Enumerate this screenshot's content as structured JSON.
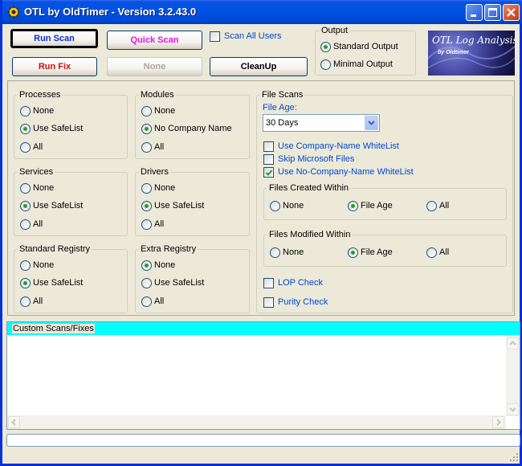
{
  "window": {
    "title": "OTL by OldTimer - Version 3.2.43.0"
  },
  "toolbar": {
    "run_scan": "Run Scan",
    "quick_scan": "Quick Scan",
    "scan_all_users": "Scan All Users",
    "run_fix": "Run Fix",
    "none": "None",
    "cleanup": "CleanUp"
  },
  "output": {
    "label": "Output",
    "standard": "Standard Output",
    "minimal": "Minimal Output",
    "selected": "Standard Output"
  },
  "logo": {
    "title": "OTL Log Analysis",
    "subtitle": "by Oldtimer"
  },
  "groups": {
    "processes": {
      "label": "Processes",
      "options": [
        "None",
        "Use SafeList",
        "All"
      ],
      "selected": "Use SafeList"
    },
    "modules": {
      "label": "Modules",
      "options": [
        "None",
        "No Company Name",
        "All"
      ],
      "selected": "No Company Name"
    },
    "services": {
      "label": "Services",
      "options": [
        "None",
        "Use SafeList",
        "All"
      ],
      "selected": "Use SafeList"
    },
    "drivers": {
      "label": "Drivers",
      "options": [
        "None",
        "Use SafeList",
        "All"
      ],
      "selected": "Use SafeList"
    },
    "standard_registry": {
      "label": "Standard Registry",
      "options": [
        "None",
        "Use SafeList",
        "All"
      ],
      "selected": "Use SafeList"
    },
    "extra_registry": {
      "label": "Extra Registry",
      "options": [
        "None",
        "Use SafeList",
        "All"
      ],
      "selected": "None"
    }
  },
  "file_scans": {
    "label": "File Scans",
    "file_age_label": "File Age:",
    "file_age_value": "30 Days",
    "use_company_whitelist": "Use Company-Name WhiteList",
    "skip_microsoft": "Skip Microsoft Files",
    "use_nocompany_whitelist": "Use No-Company-Name WhiteList",
    "nocompany_checked": true,
    "files_created": {
      "label": "Files Created Within",
      "options": [
        "None",
        "File Age",
        "All"
      ],
      "selected": "File Age"
    },
    "files_modified": {
      "label": "Files Modified Within",
      "options": [
        "None",
        "File Age",
        "All"
      ],
      "selected": "File Age"
    },
    "lop_check": "LOP Check",
    "purity_check": "Purity Check"
  },
  "custom": {
    "label": "Custom Scans/Fixes",
    "value": ""
  },
  "status": {
    "text": ""
  },
  "colors": {
    "run_scan": "#0a2ccf",
    "quick_scan": "#e018e0",
    "run_fix": "#d01010",
    "blue_text": "#0046d5",
    "custom_header": "#00ffff"
  }
}
